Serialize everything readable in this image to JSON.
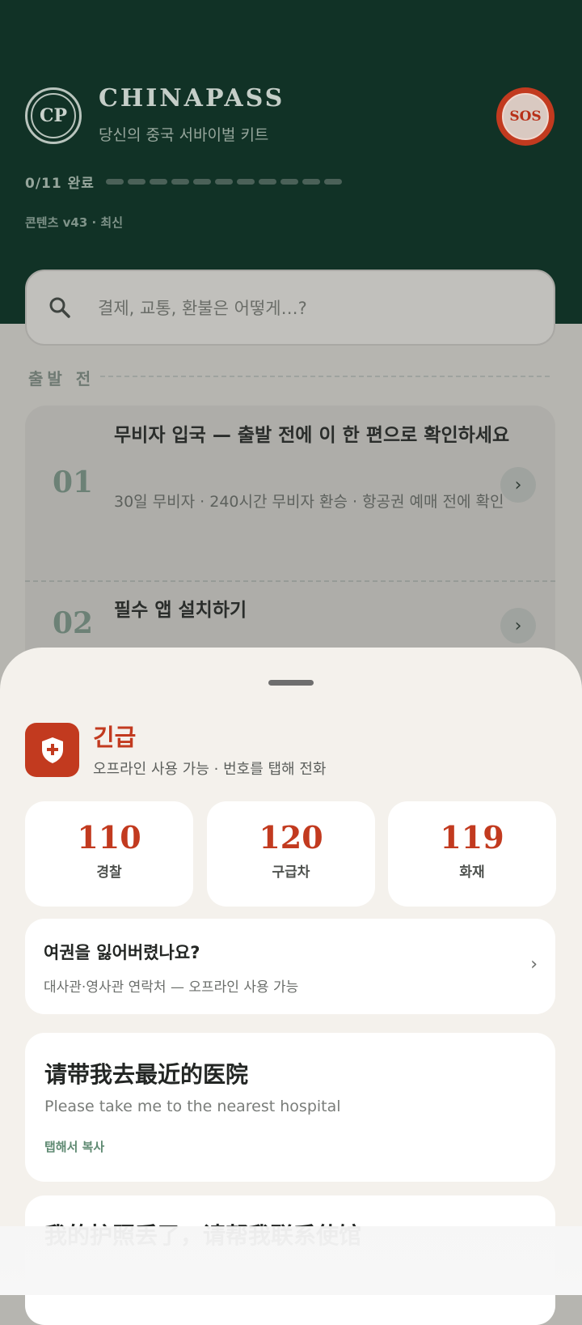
{
  "header": {
    "logo_text": "CP",
    "brand": "CHINAPASS",
    "tagline": "당신의 중국 서바이벌 키트",
    "sos_label": "SOS",
    "progress_label": "0/11 완료",
    "progress": {
      "done": 0,
      "total": 11
    },
    "version": "콘텐츠 v43 · 최신"
  },
  "search": {
    "placeholder": "결제, 교통, 환불은 어떻게…?"
  },
  "section": {
    "label": "출발 전",
    "items": [
      {
        "num": "01",
        "title": "무비자 입국 — 출발 전에 이 한 편으로 확인하세요",
        "subtitle": "30일 무비자 · 240시간 무비자 환승 · 항공권 예매 전에 확인"
      },
      {
        "num": "02",
        "title": "필수 앱 설치하기",
        "subtitle": ""
      }
    ]
  },
  "sheet": {
    "title": "긴급",
    "subtitle": "오프라인 사용 가능 · 번호를 탭해 전화",
    "numbers": [
      {
        "number": "110",
        "label": "경찰"
      },
      {
        "number": "120",
        "label": "구급차"
      },
      {
        "number": "119",
        "label": "화재"
      }
    ],
    "passport": {
      "title": "여권을 잃어버렸나요?",
      "subtitle": "대사관·영사관 연락처 — 오프라인 사용 가능",
      "chevron": "›"
    },
    "phrases": [
      {
        "zh": "请带我去最近的医院",
        "en": "Please take me to the nearest hospital",
        "action": "탭해서 복사"
      },
      {
        "zh": "我的护照丢了，请帮我联系使馆"
      }
    ]
  },
  "colors": {
    "header_bg": "#113226",
    "accent_red": "#c23a1f",
    "sheet_bg": "#f4f1ec",
    "green_text": "#5f8a72"
  }
}
